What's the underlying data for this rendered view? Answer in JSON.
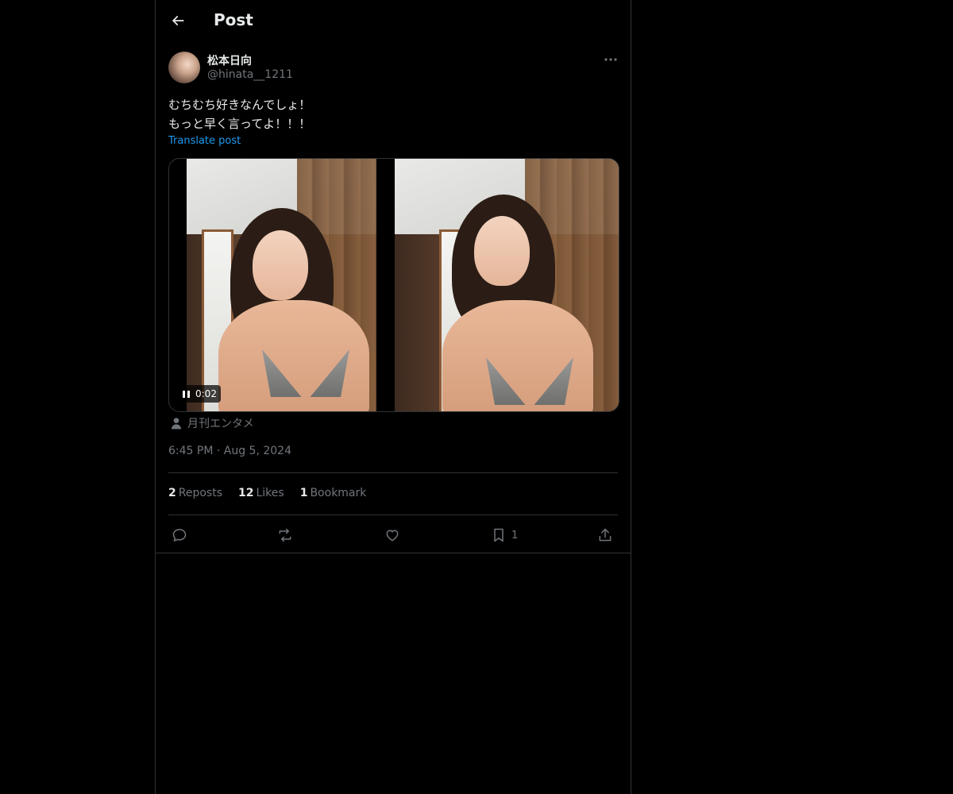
{
  "header": {
    "title": "Post"
  },
  "author": {
    "display_name": "松本日向",
    "handle": "@hinata__1211"
  },
  "post": {
    "text": "むちむち好きなんでしょ！\nもっと早く言ってよ！！！",
    "translate_label": "Translate post",
    "media": {
      "video_time": "0:02"
    },
    "source_label": "月刊エンタメ",
    "timestamp": "6:45 PM · Aug 5, 2024"
  },
  "stats": {
    "reposts_count": "2",
    "reposts_label": "Reposts",
    "likes_count": "12",
    "likes_label": "Likes",
    "bookmarks_count": "1",
    "bookmarks_label": "Bookmark"
  },
  "actions": {
    "bookmark_count": "1"
  },
  "icons": [
    "back-arrow-icon",
    "more-icon",
    "pause-icon",
    "person-icon",
    "reply-icon",
    "repost-icon",
    "like-icon",
    "bookmark-icon",
    "share-icon"
  ],
  "colors": {
    "background": "#000000",
    "text": "#e7e9ea",
    "muted": "#71767b",
    "link": "#1d9bf0",
    "border": "#2f3336"
  }
}
